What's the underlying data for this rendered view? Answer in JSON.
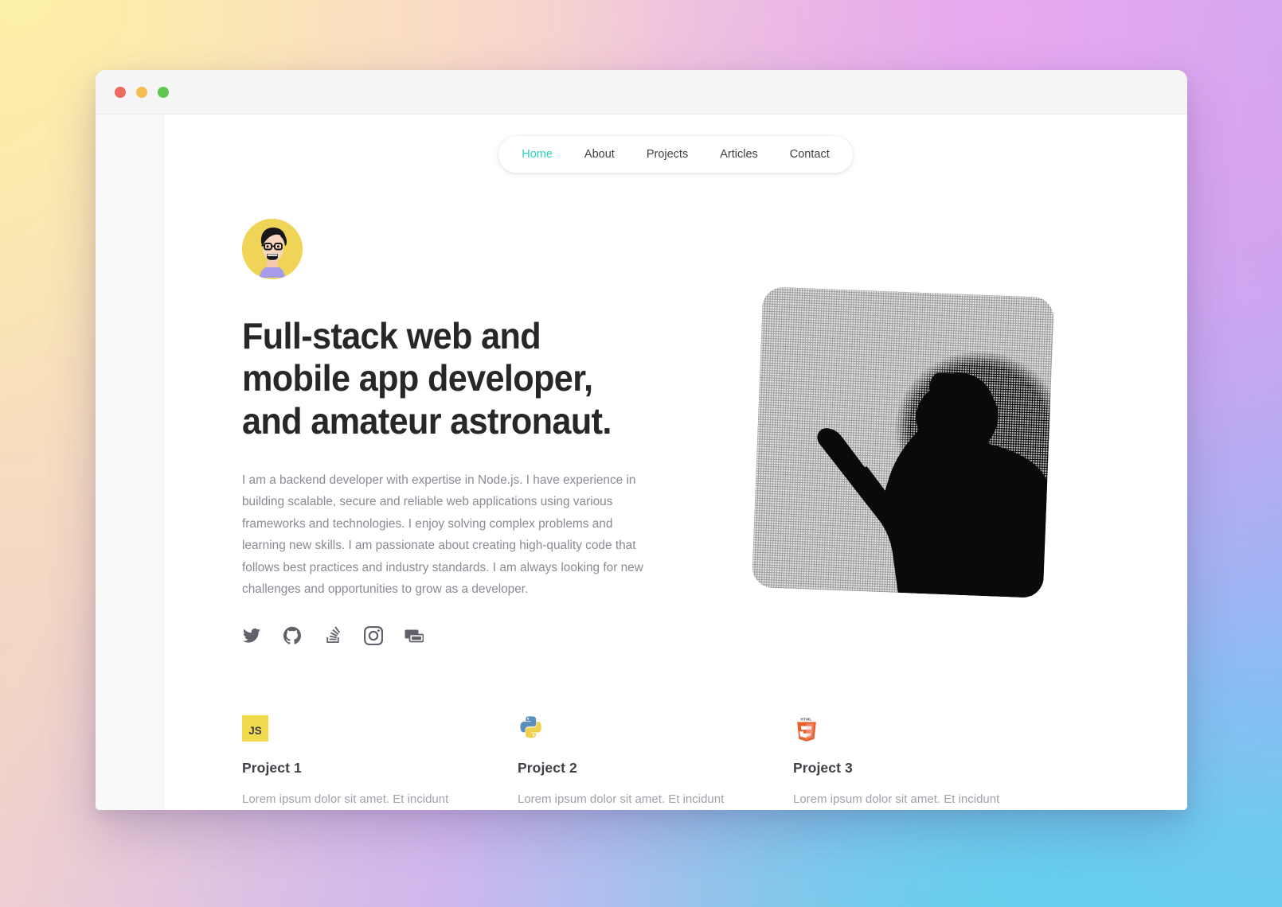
{
  "window": {
    "traffic_lights": [
      {
        "name": "close",
        "color": "#ed6a5e"
      },
      {
        "name": "minimize",
        "color": "#f5bd4f"
      },
      {
        "name": "maximize",
        "color": "#61c554"
      }
    ]
  },
  "nav": {
    "items": [
      {
        "label": "Home",
        "active": true
      },
      {
        "label": "About",
        "active": false
      },
      {
        "label": "Projects",
        "active": false
      },
      {
        "label": "Articles",
        "active": false
      },
      {
        "label": "Contact",
        "active": false
      }
    ],
    "active_color": "#2dd4bf",
    "inactive_color": "#3f3f46"
  },
  "hero": {
    "avatar_alt": "avatar-illustration",
    "avatar_bg": "#efd458",
    "headline": "Full-stack web and mobile app developer, and amateur astronaut.",
    "bio": "I am a backend developer with expertise in Node.js. I have experience in building scalable, secure and reliable web applications using various frameworks and technologies. I enjoy solving complex problems and learning new skills. I am passionate about creating high-quality code that follows best practices and industry standards. I am always looking for new challenges and opportunities to grow as a developer.",
    "photo_alt": "black-and-white halftone photo of a person wearing a cap reaching upward"
  },
  "socials": [
    {
      "name": "twitter-icon",
      "label": "Twitter"
    },
    {
      "name": "github-icon",
      "label": "GitHub"
    },
    {
      "name": "stackoverflow-icon",
      "label": "Stack Overflow"
    },
    {
      "name": "instagram-icon",
      "label": "Instagram"
    },
    {
      "name": "devto-icon",
      "label": "Dev.to"
    }
  ],
  "projects": [
    {
      "icon": "javascript-icon",
      "icon_colors": {
        "bg": "#f0db4f",
        "fg": "#3f3f46"
      },
      "title": "Project 1",
      "description": "Lorem ipsum dolor sit amet. Et incidunt voluptatem ex tempore repellendus qui"
    },
    {
      "icon": "python-icon",
      "icon_colors": {
        "bg": "#5a8fbb",
        "fg": "#f0d04f"
      },
      "title": "Project 2",
      "description": "Lorem ipsum dolor sit amet. Et incidunt voluptatem ex tempore repellendus qui"
    },
    {
      "icon": "html5-icon",
      "icon_colors": {
        "bg": "#e8612c",
        "fg": "#f0846a"
      },
      "title": "Project 3",
      "description": "Lorem ipsum dolor sit amet. Et incidunt voluptatem ex tempore repellendus qui"
    }
  ]
}
